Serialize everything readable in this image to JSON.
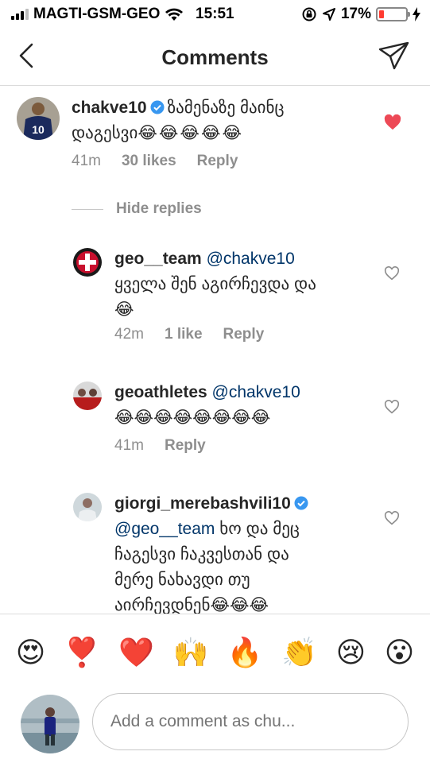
{
  "status_bar": {
    "carrier": "MAGTI-GSM-GEO",
    "time": "15:51",
    "battery": "17%"
  },
  "header": {
    "title": "Comments"
  },
  "comments": [
    {
      "username": "chakve10",
      "text": "ზამენაზე მაინც",
      "text_line2": "დაგესვი",
      "emojis": "😂😂😂😂😂",
      "time": "41m",
      "likes": "30 likes",
      "reply": "Reply",
      "liked": true,
      "verified": true
    }
  ],
  "hide_replies": "Hide replies",
  "replies": [
    {
      "username": "geo__team",
      "mention": "@chakve10",
      "text": "ყველა შენ აგირჩევდა და",
      "emojis": "😂",
      "time": "42m",
      "likes": "1 like",
      "reply": "Reply"
    },
    {
      "username": "geoathletes",
      "mention": "@chakve10",
      "emojis": "😂😂😂😂😂😂😂😂",
      "time": "41m",
      "reply": "Reply"
    },
    {
      "username": "giorgi_merebashvili10",
      "mention": "@geo__team",
      "text1": "ხო და მეც",
      "text2": "ჩაგესვი ჩაკვესთან და",
      "text3": "მერე ნახავდი თუ",
      "text4": "აირჩევდნენ",
      "emojis": "😂😂😂",
      "verified": true
    }
  ],
  "emoji_bar": [
    "😍",
    "❣️",
    "❤️",
    "🙌",
    "🔥",
    "👏",
    "😢",
    "😮"
  ],
  "input": {
    "placeholder": "Add a comment as chu..."
  },
  "colors": {
    "heart_liked": "#ed4956",
    "mention": "#003569",
    "meta_gray": "#8e8e8e",
    "verified_blue": "#3897f0",
    "battery_low": "#ff3b30"
  }
}
